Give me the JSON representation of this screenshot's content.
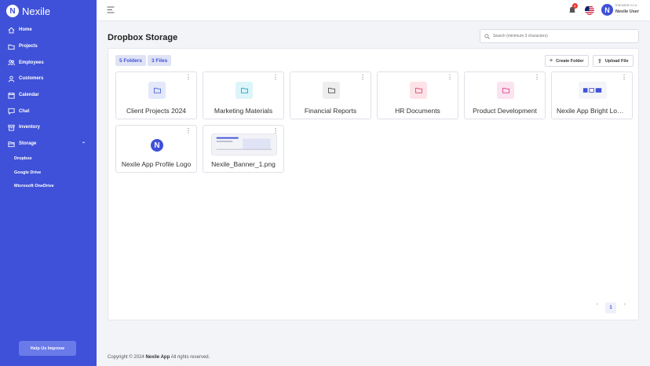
{
  "app": {
    "name": "Nexile"
  },
  "sidebar": {
    "items": [
      {
        "label": "Home",
        "icon": "home-icon"
      },
      {
        "label": "Projects",
        "icon": "folder-icon"
      },
      {
        "label": "Employees",
        "icon": "users-icon"
      },
      {
        "label": "Customers",
        "icon": "user-icon"
      },
      {
        "label": "Calendar",
        "icon": "calendar-icon"
      },
      {
        "label": "Chat",
        "icon": "chat-icon"
      },
      {
        "label": "Inventory",
        "icon": "box-icon"
      },
      {
        "label": "Storage",
        "icon": "storage-icon"
      }
    ],
    "storage_sub": [
      "Dropbox",
      "Google Drive",
      "Microsoft OneDrive"
    ],
    "help_label": "Help Us Improve"
  },
  "topbar": {
    "notification_count": "6",
    "company": "Innovent s.r.o.",
    "user_name": "Nexile User"
  },
  "page": {
    "title": "Dropbox Storage",
    "search_placeholder": "Search (minimum 3 characters)"
  },
  "counts": {
    "folders": "5 Folders",
    "files": "3 Files"
  },
  "actions": {
    "create_folder": "Create Folder",
    "upload_file": "Upload File"
  },
  "items": [
    {
      "name": "Client Projects 2024",
      "kind": "folder",
      "color": "#4a67d6",
      "bg": "#e3e8fa"
    },
    {
      "name": "Marketing Materials",
      "kind": "folder",
      "color": "#1aa7c4",
      "bg": "#dcf5f9"
    },
    {
      "name": "Financial Reports",
      "kind": "folder",
      "color": "#555555",
      "bg": "#eeeeee"
    },
    {
      "name": "HR Documents",
      "kind": "folder",
      "color": "#e04868",
      "bg": "#fde3e8"
    },
    {
      "name": "Product Development",
      "kind": "folder",
      "color": "#e0488f",
      "bg": "#fbe3ef"
    },
    {
      "name": "Nexile App Bright Logos",
      "kind": "file"
    },
    {
      "name": "Nexile App Profile Logo",
      "kind": "file"
    },
    {
      "name": "Nexile_Banner_1.png",
      "kind": "file"
    }
  ],
  "pagination": {
    "current": "1",
    "prev": "‹",
    "next": "›"
  },
  "footer": {
    "prefix": "Copyright © 2024",
    "brand": "Nexile App",
    "suffix": "All rights reserved."
  },
  "colors": {
    "accent": "#3f51d8"
  }
}
